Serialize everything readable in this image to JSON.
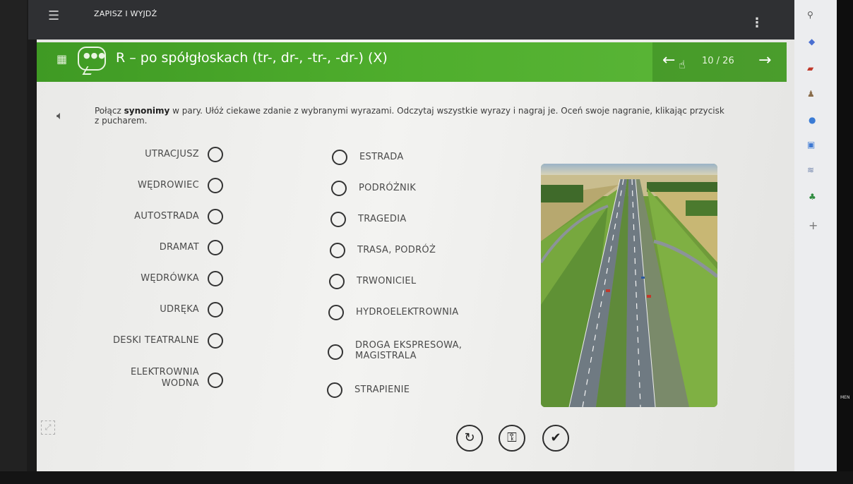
{
  "topbar": {
    "save_exit_label": "ZAPISZ I WYJDŹ"
  },
  "header": {
    "title": "R – po spółgłoskach (tr-, dr-, -tr-, -dr-) (X)",
    "page_counter": "10 / 26"
  },
  "instruction": {
    "part1": "Połącz ",
    "bold": "synonimy",
    "part2": " w pary. Ułóż ciekawe zdanie z wybranymi wyrazami. Odczytaj wszystkie wyrazy i nagraj je. Oceń swoje nagranie, klikając przycisk z pucharem."
  },
  "left_words": [
    {
      "label": "UTRACJUSZ"
    },
    {
      "label": "WĘDROWIEC"
    },
    {
      "label": "AUTOSTRADA"
    },
    {
      "label": "DRAMAT"
    },
    {
      "label": "WĘDRÓWKA"
    },
    {
      "label": "UDRĘKA"
    },
    {
      "label": "DESKI TEATRALNE"
    },
    {
      "label": "ELEKTROWNIA WODNA",
      "line1": "ELEKTROWNIA",
      "line2": "WODNA"
    }
  ],
  "right_words": [
    {
      "label": "ESTRADA"
    },
    {
      "label": "PODRÓŻNIK"
    },
    {
      "label": "TRAGEDIA"
    },
    {
      "label": "TRASA, PODRÓŻ"
    },
    {
      "label": "TRWONICIEL"
    },
    {
      "label": "HYDROELEKTROWNIA"
    },
    {
      "label": "DROGA EKSPRESOWA, MAGISTRALA",
      "line1": "DROGA EKSPRESOWA,",
      "line2": "MAGISTRALA"
    },
    {
      "label": "STRAPIENIE"
    }
  ],
  "image": {
    "description": "highway-aerial-photo"
  },
  "colors": {
    "header_green": "#4fae2d",
    "topbar": "#2f3033"
  },
  "chrome_side_text": "MEN"
}
